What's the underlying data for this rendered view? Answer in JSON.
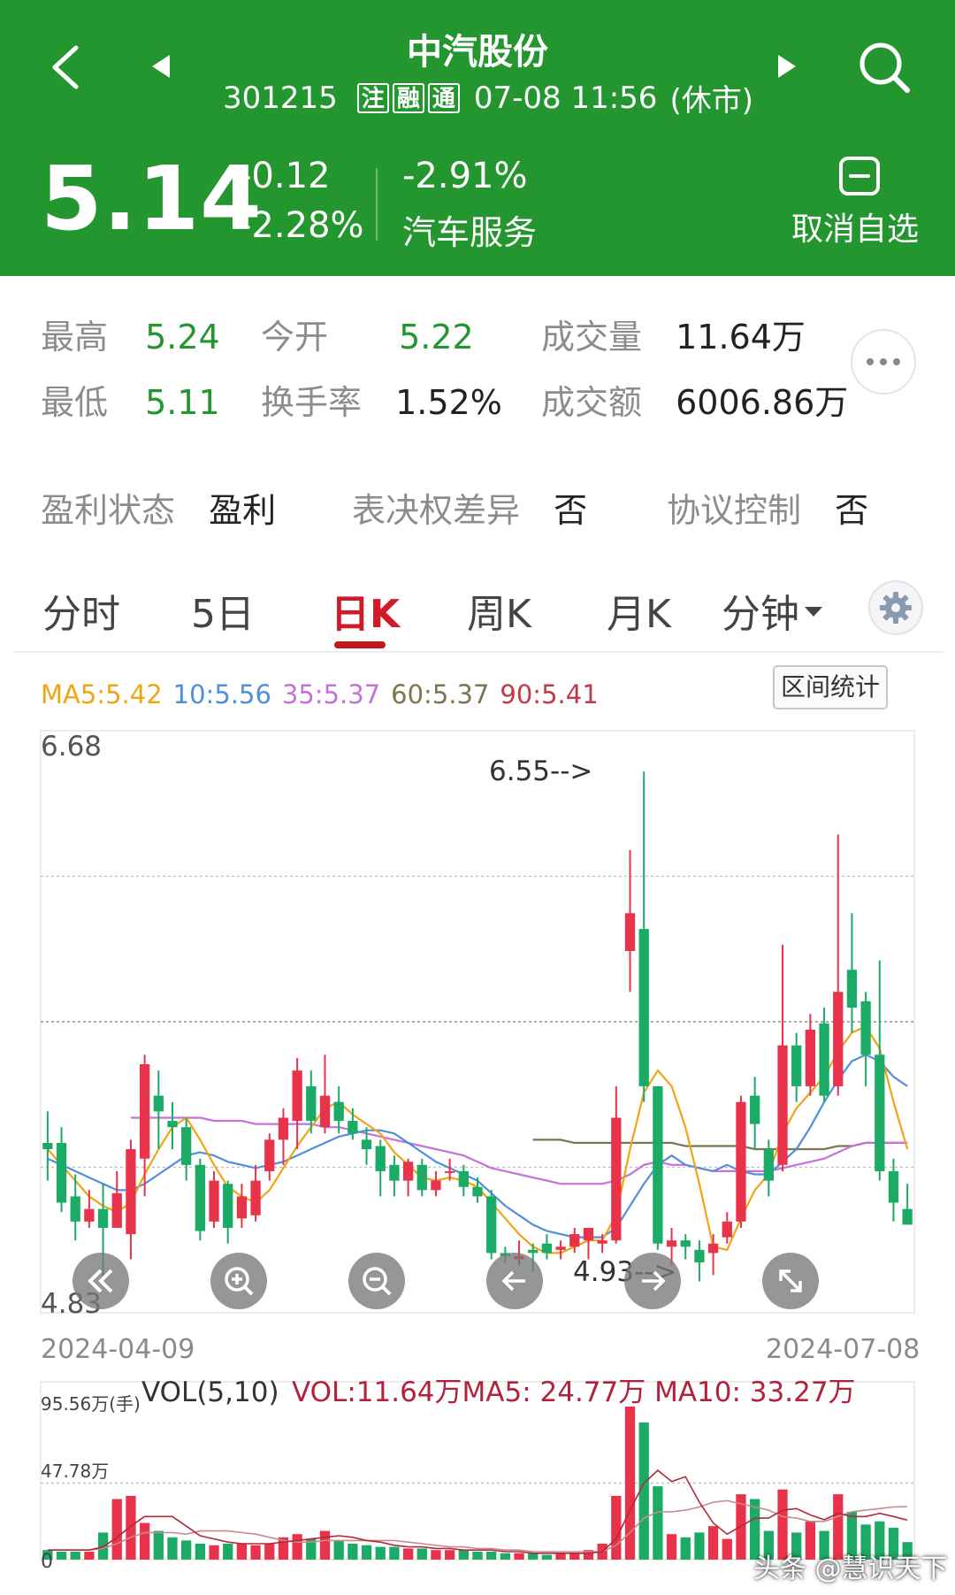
{
  "header": {
    "stock_name": "中汽股份",
    "code": "301215",
    "tags": [
      "注",
      "融",
      "通"
    ],
    "datetime": "07-08 11:56",
    "status": "(休市)",
    "price": "5.14",
    "change": "-0.12",
    "change_pct": "-2.28%",
    "sector_change": "-2.91%",
    "sector_name": "汽车服务",
    "unfollow_label": "取消自选"
  },
  "quote": {
    "high_label": "最高",
    "high": "5.24",
    "open_label": "今开",
    "open": "5.22",
    "volume_label": "成交量",
    "volume": "11.64万",
    "low_label": "最低",
    "low": "5.11",
    "turnover_label": "换手率",
    "turnover": "1.52%",
    "amount_label": "成交额",
    "amount": "6006.86万"
  },
  "attrs": {
    "profit_label": "盈利状态",
    "profit": "盈利",
    "voting_label": "表决权差异",
    "voting": "否",
    "agreement_label": "协议控制",
    "agreement": "否"
  },
  "tabs": [
    "分时",
    "5日",
    "日K",
    "周K",
    "月K",
    "分钟"
  ],
  "ma_legend": {
    "ma5": "MA5:5.42",
    "ma10": "10:5.56",
    "ma35": "35:5.37",
    "ma60": "60:5.37",
    "ma90": "90:5.41"
  },
  "range_stats_label": "区间统计",
  "colors": {
    "up": "#e8334a",
    "down": "#1cab66",
    "brand": "#23962f",
    "ma5": "#f0a515",
    "ma10": "#4f8fdc",
    "ma35": "#c671d8",
    "ma60": "#7c7550",
    "ma90": "#c23a45"
  },
  "controls": [
    "rewind-icon",
    "zoom-in-icon",
    "zoom-out-icon",
    "arrow-left-icon",
    "arrow-right-icon",
    "expand-icon"
  ],
  "volume": {
    "title": "VOL(5,10)",
    "values_text": "VOL:11.64万MA5: 24.77万 MA10: 33.27万",
    "max_label": "95.56万(手)",
    "mid_label": "47.78万",
    "zero_label": "0"
  },
  "watermark": "头条 @慧识天下",
  "chart_data": {
    "type": "candlestick",
    "x_start": "2024-04-09",
    "x_end": "2024-07-08",
    "ylim": [
      4.83,
      6.68
    ],
    "y_top_label": "6.68",
    "y_bottom_label": "4.83",
    "max_note": "6.55-->",
    "min_note": "4.93-->",
    "candles": [
      [
        5.37,
        5.35,
        5.47,
        5.25
      ],
      [
        5.37,
        5.18,
        5.42,
        5.15
      ],
      [
        5.2,
        5.12,
        5.27,
        5.06
      ],
      [
        5.12,
        5.16,
        5.22,
        5.1
      ],
      [
        5.16,
        5.1,
        5.24,
        4.93
      ],
      [
        5.1,
        5.21,
        5.28,
        5.1
      ],
      [
        5.08,
        5.35,
        5.38,
        5.0
      ],
      [
        5.32,
        5.62,
        5.65,
        5.2
      ],
      [
        5.52,
        5.47,
        5.6,
        5.35
      ],
      [
        5.44,
        5.42,
        5.5,
        5.35
      ],
      [
        5.42,
        5.3,
        5.45,
        5.25
      ],
      [
        5.3,
        5.09,
        5.32,
        5.06
      ],
      [
        5.12,
        5.25,
        5.28,
        5.1
      ],
      [
        5.24,
        5.1,
        5.25,
        5.05
      ],
      [
        5.13,
        5.2,
        5.24,
        5.1
      ],
      [
        5.14,
        5.25,
        5.3,
        5.12
      ],
      [
        5.28,
        5.38,
        5.4,
        5.25
      ],
      [
        5.38,
        5.45,
        5.48,
        5.3
      ],
      [
        5.44,
        5.6,
        5.64,
        5.35
      ],
      [
        5.55,
        5.44,
        5.6,
        5.4
      ],
      [
        5.42,
        5.52,
        5.65,
        5.4
      ],
      [
        5.5,
        5.44,
        5.55,
        5.4
      ],
      [
        5.44,
        5.4,
        5.48,
        5.38
      ],
      [
        5.38,
        5.35,
        5.42,
        5.3
      ],
      [
        5.36,
        5.28,
        5.38,
        5.2
      ],
      [
        5.3,
        5.25,
        5.33,
        5.2
      ],
      [
        5.25,
        5.31,
        5.32,
        5.2
      ],
      [
        5.3,
        5.22,
        5.32,
        5.2
      ],
      [
        5.22,
        5.25,
        5.28,
        5.2
      ],
      [
        5.28,
        5.28,
        5.32,
        5.25
      ],
      [
        5.28,
        5.23,
        5.3,
        5.2
      ],
      [
        5.23,
        5.2,
        5.26,
        5.18
      ],
      [
        5.2,
        5.02,
        5.22,
        5.0
      ],
      [
        5.02,
        5.01,
        5.04,
        4.99
      ],
      [
        5.0,
        5.01,
        5.06,
        4.98
      ],
      [
        5.03,
        5.02,
        5.05,
        4.96
      ],
      [
        5.05,
        5.02,
        5.08,
        5.0
      ],
      [
        5.03,
        5.04,
        5.06,
        5.0
      ],
      [
        5.04,
        5.08,
        5.1,
        5.02
      ],
      [
        5.06,
        5.1,
        5.1,
        5.0
      ],
      [
        5.05,
        5.06,
        5.08,
        5.02
      ],
      [
        5.06,
        5.45,
        5.55,
        5.05
      ],
      [
        5.98,
        6.1,
        6.3,
        5.85
      ],
      [
        6.05,
        5.55,
        6.55,
        5.5
      ],
      [
        5.55,
        5.05,
        5.55,
        5.03
      ],
      [
        5.04,
        5.06,
        5.1,
        4.98
      ],
      [
        5.06,
        5.04,
        5.08,
        5.0
      ],
      [
        5.03,
        4.99,
        5.06,
        4.93
      ],
      [
        5.02,
        5.05,
        5.08,
        4.95
      ],
      [
        5.07,
        5.12,
        5.15,
        5.05
      ],
      [
        5.12,
        5.5,
        5.52,
        5.1
      ],
      [
        5.52,
        5.43,
        5.58,
        5.35
      ],
      [
        5.35,
        5.25,
        5.38,
        5.2
      ],
      [
        5.3,
        5.68,
        6.0,
        5.28
      ],
      [
        5.68,
        5.55,
        5.72,
        5.5
      ],
      [
        5.55,
        5.73,
        5.78,
        5.52
      ],
      [
        5.75,
        5.52,
        5.8,
        5.5
      ],
      [
        5.55,
        5.85,
        6.35,
        5.52
      ],
      [
        5.92,
        5.8,
        6.1,
        5.72
      ],
      [
        5.82,
        5.65,
        5.85,
        5.55
      ],
      [
        5.65,
        5.28,
        5.95,
        5.25
      ],
      [
        5.28,
        5.18,
        5.32,
        5.12
      ],
      [
        5.16,
        5.11,
        5.24,
        5.11
      ]
    ],
    "ma5": [
      5.35,
      5.3,
      5.25,
      5.2,
      5.17,
      5.15,
      5.18,
      5.27,
      5.35,
      5.42,
      5.45,
      5.38,
      5.3,
      5.23,
      5.2,
      5.18,
      5.22,
      5.29,
      5.36,
      5.42,
      5.48,
      5.5,
      5.46,
      5.43,
      5.4,
      5.34,
      5.3,
      5.26,
      5.25,
      5.26,
      5.25,
      5.23,
      5.18,
      5.13,
      5.08,
      5.04,
      5.02,
      5.02,
      5.04,
      5.06,
      5.06,
      5.14,
      5.35,
      5.53,
      5.6,
      5.55,
      5.42,
      5.24,
      5.04,
      5.03,
      5.13,
      5.22,
      5.27,
      5.4,
      5.48,
      5.53,
      5.58,
      5.66,
      5.72,
      5.74,
      5.67,
      5.5,
      5.35
    ],
    "ma10": [
      5.32,
      5.3,
      5.28,
      5.26,
      5.24,
      5.22,
      5.22,
      5.24,
      5.27,
      5.3,
      5.33,
      5.34,
      5.33,
      5.31,
      5.3,
      5.29,
      5.3,
      5.31,
      5.33,
      5.35,
      5.37,
      5.39,
      5.4,
      5.41,
      5.41,
      5.4,
      5.37,
      5.34,
      5.31,
      5.29,
      5.27,
      5.25,
      5.21,
      5.17,
      5.14,
      5.11,
      5.09,
      5.08,
      5.07,
      5.07,
      5.07,
      5.1,
      5.17,
      5.24,
      5.3,
      5.33,
      5.3,
      5.29,
      5.28,
      5.3,
      5.28,
      5.27,
      5.27,
      5.31,
      5.35,
      5.42,
      5.5,
      5.57,
      5.63,
      5.65,
      5.63,
      5.58,
      5.55
    ],
    "ma35": [
      null,
      null,
      null,
      null,
      null,
      null,
      5.45,
      5.45,
      5.45,
      5.45,
      5.45,
      5.45,
      5.44,
      5.44,
      5.44,
      5.43,
      5.43,
      5.43,
      5.43,
      5.43,
      5.42,
      5.42,
      5.41,
      5.4,
      5.39,
      5.38,
      5.37,
      5.36,
      5.35,
      5.34,
      5.33,
      5.31,
      5.29,
      5.28,
      5.27,
      5.26,
      5.25,
      5.24,
      5.24,
      5.24,
      5.24,
      5.25,
      5.27,
      5.3,
      5.31,
      5.3,
      5.3,
      5.29,
      5.28,
      5.28,
      5.28,
      5.28,
      5.28,
      5.29,
      5.3,
      5.31,
      5.32,
      5.34,
      5.36,
      5.37,
      5.37,
      5.37,
      5.37
    ],
    "ma60": [
      null,
      null,
      null,
      null,
      null,
      null,
      null,
      null,
      null,
      null,
      null,
      null,
      null,
      null,
      null,
      null,
      null,
      null,
      null,
      null,
      null,
      null,
      null,
      null,
      null,
      null,
      null,
      null,
      null,
      null,
      null,
      null,
      null,
      null,
      null,
      5.38,
      5.38,
      5.38,
      5.37,
      5.37,
      5.37,
      5.37,
      5.37,
      5.37,
      5.37,
      5.37,
      5.36,
      5.36,
      5.36,
      5.36,
      5.36,
      5.35,
      5.35,
      5.35,
      5.35,
      5.35,
      5.35,
      5.36,
      5.36,
      5.37,
      5.37,
      5.37,
      5.37
    ],
    "ma90": [],
    "volume": [
      6,
      5,
      5,
      5,
      17,
      38,
      40,
      23,
      18,
      14,
      12,
      10,
      9,
      10,
      10,
      9,
      10,
      14,
      16,
      13,
      18,
      12,
      10,
      9,
      8,
      8,
      7,
      7,
      6,
      6,
      6,
      5,
      5,
      4,
      4,
      4,
      3,
      4,
      4,
      6,
      10,
      40,
      96,
      86,
      46,
      16,
      14,
      17,
      21,
      13,
      41,
      38,
      18,
      44,
      17,
      24,
      18,
      41,
      30,
      22,
      24,
      20,
      11
    ],
    "vol_ma5": [
      6,
      6,
      6,
      6,
      8,
      14,
      21,
      27,
      27,
      27,
      21,
      15,
      13,
      11,
      10,
      10,
      10,
      11,
      12,
      13,
      14,
      15,
      14,
      12,
      11,
      9,
      8,
      8,
      7,
      7,
      6,
      6,
      6,
      5,
      5,
      4,
      4,
      4,
      4,
      4,
      5,
      13,
      31,
      48,
      56,
      49,
      52,
      36,
      23,
      16,
      21,
      26,
      26,
      31,
      32,
      28,
      25,
      29,
      27,
      27,
      29,
      27,
      24.77
    ],
    "vol_ma10": [
      6,
      6,
      6,
      6,
      7,
      10,
      14,
      17,
      17,
      17,
      16,
      18,
      18,
      18,
      17,
      16,
      14,
      12,
      11,
      11,
      12,
      12,
      12,
      12,
      12,
      12,
      11,
      10,
      9,
      8,
      8,
      7,
      7,
      6,
      6,
      5,
      5,
      5,
      5,
      5,
      5,
      9,
      17,
      26,
      30,
      30,
      31,
      33,
      36,
      37,
      35,
      33,
      31,
      27,
      26,
      24,
      24,
      27,
      30,
      31,
      32,
      33,
      33.27
    ]
  }
}
